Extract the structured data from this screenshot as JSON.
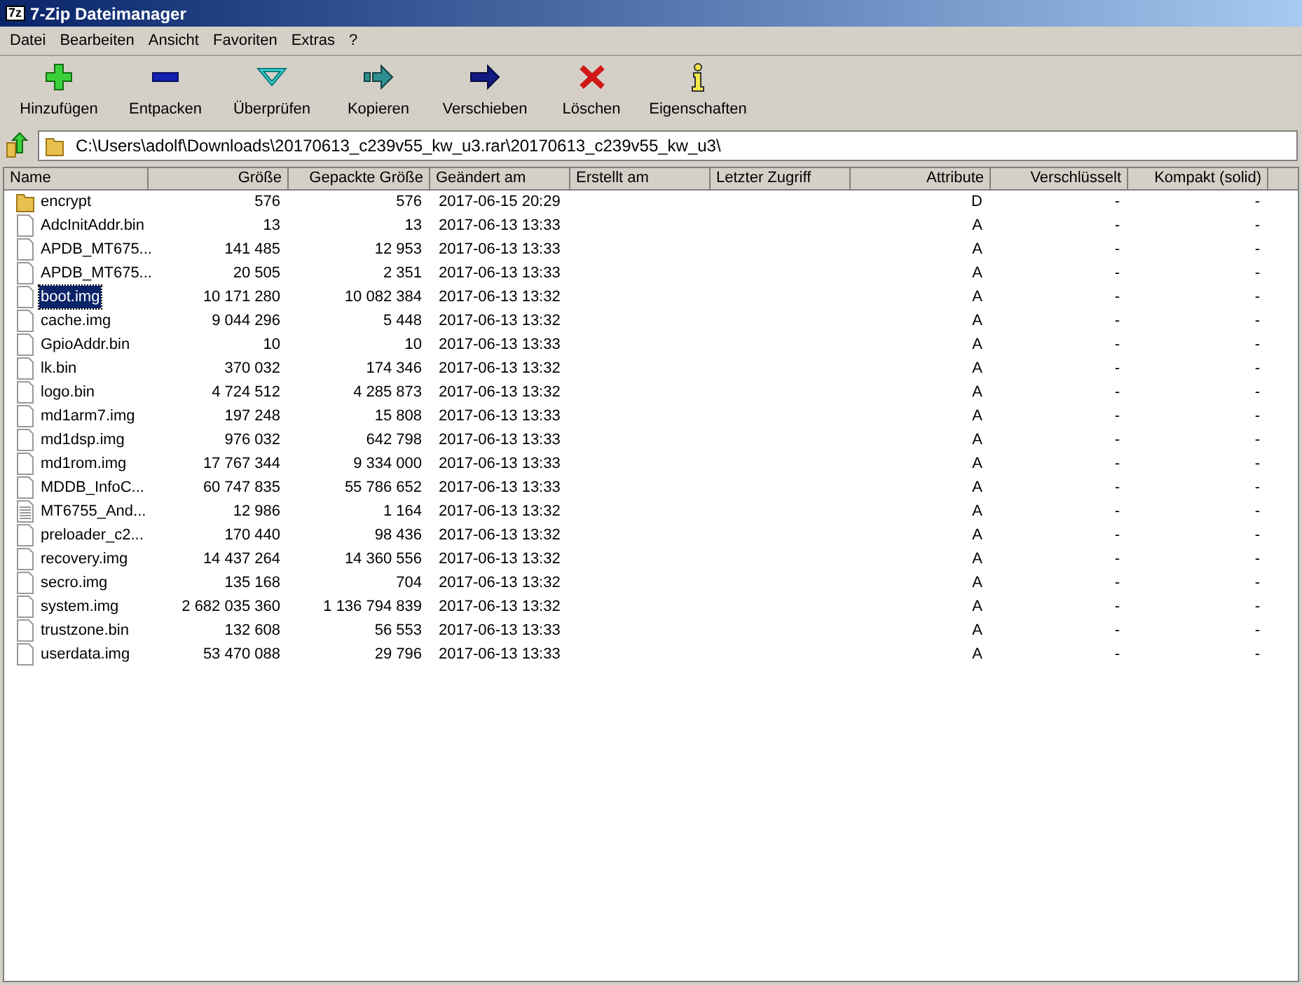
{
  "window": {
    "title": "7-Zip Dateimanager",
    "app_icon": "7z"
  },
  "menu": [
    "Datei",
    "Bearbeiten",
    "Ansicht",
    "Favoriten",
    "Extras",
    "?"
  ],
  "toolbar": [
    {
      "label": "Hinzufügen",
      "kind": "add"
    },
    {
      "label": "Entpacken",
      "kind": "extract"
    },
    {
      "label": "Überprüfen",
      "kind": "test"
    },
    {
      "label": "Kopieren",
      "kind": "copy"
    },
    {
      "label": "Verschieben",
      "kind": "move"
    },
    {
      "label": "Löschen",
      "kind": "delete"
    },
    {
      "label": "Eigenschaften",
      "kind": "info"
    }
  ],
  "path": "C:\\Users\\adolf\\Downloads\\20170613_c239v55_kw_u3.rar\\20170613_c239v55_kw_u3\\",
  "table": {
    "columns": [
      {
        "label": "Name"
      },
      {
        "label": "Größe"
      },
      {
        "label": "Gepackte Größe"
      },
      {
        "label": "Geändert am"
      },
      {
        "label": "Erstellt am"
      },
      {
        "label": "Letzter Zugriff"
      },
      {
        "label": "Attribute"
      },
      {
        "label": "Verschlüsselt"
      },
      {
        "label": "Kompakt (solid)"
      }
    ],
    "rows": [
      {
        "kind": "folder",
        "selected": false,
        "cells": [
          "encrypt",
          "576",
          "576",
          "2017-06-15 20:29",
          "",
          "",
          "D",
          "-",
          "-"
        ]
      },
      {
        "kind": "file",
        "selected": false,
        "cells": [
          "AdcInitAddr.bin",
          "13",
          "13",
          "2017-06-13 13:33",
          "",
          "",
          "A",
          "-",
          "-"
        ]
      },
      {
        "kind": "file",
        "selected": false,
        "cells": [
          "APDB_MT675...",
          "141 485",
          "12 953",
          "2017-06-13 13:33",
          "",
          "",
          "A",
          "-",
          "-"
        ]
      },
      {
        "kind": "file",
        "selected": false,
        "cells": [
          "APDB_MT675...",
          "20 505",
          "2 351",
          "2017-06-13 13:33",
          "",
          "",
          "A",
          "-",
          "-"
        ]
      },
      {
        "kind": "file",
        "selected": true,
        "cells": [
          "boot.img",
          "10 171 280",
          "10 082 384",
          "2017-06-13 13:32",
          "",
          "",
          "A",
          "-",
          "-"
        ]
      },
      {
        "kind": "file",
        "selected": false,
        "cells": [
          "cache.img",
          "9 044 296",
          "5 448",
          "2017-06-13 13:32",
          "",
          "",
          "A",
          "-",
          "-"
        ]
      },
      {
        "kind": "file",
        "selected": false,
        "cells": [
          "GpioAddr.bin",
          "10",
          "10",
          "2017-06-13 13:33",
          "",
          "",
          "A",
          "-",
          "-"
        ]
      },
      {
        "kind": "file",
        "selected": false,
        "cells": [
          "lk.bin",
          "370 032",
          "174 346",
          "2017-06-13 13:32",
          "",
          "",
          "A",
          "-",
          "-"
        ]
      },
      {
        "kind": "file",
        "selected": false,
        "cells": [
          "logo.bin",
          "4 724 512",
          "4 285 873",
          "2017-06-13 13:32",
          "",
          "",
          "A",
          "-",
          "-"
        ]
      },
      {
        "kind": "file",
        "selected": false,
        "cells": [
          "md1arm7.img",
          "197 248",
          "15 808",
          "2017-06-13 13:33",
          "",
          "",
          "A",
          "-",
          "-"
        ]
      },
      {
        "kind": "file",
        "selected": false,
        "cells": [
          "md1dsp.img",
          "976 032",
          "642 798",
          "2017-06-13 13:33",
          "",
          "",
          "A",
          "-",
          "-"
        ]
      },
      {
        "kind": "file",
        "selected": false,
        "cells": [
          "md1rom.img",
          "17 767 344",
          "9 334 000",
          "2017-06-13 13:33",
          "",
          "",
          "A",
          "-",
          "-"
        ]
      },
      {
        "kind": "file",
        "selected": false,
        "cells": [
          "MDDB_InfoC...",
          "60 747 835",
          "55 786 652",
          "2017-06-13 13:33",
          "",
          "",
          "A",
          "-",
          "-"
        ]
      },
      {
        "kind": "text",
        "selected": false,
        "cells": [
          "MT6755_And...",
          "12 986",
          "1 164",
          "2017-06-13 13:32",
          "",
          "",
          "A",
          "-",
          "-"
        ]
      },
      {
        "kind": "file",
        "selected": false,
        "cells": [
          "preloader_c2...",
          "170 440",
          "98 436",
          "2017-06-13 13:32",
          "",
          "",
          "A",
          "-",
          "-"
        ]
      },
      {
        "kind": "file",
        "selected": false,
        "cells": [
          "recovery.img",
          "14 437 264",
          "14 360 556",
          "2017-06-13 13:32",
          "",
          "",
          "A",
          "-",
          "-"
        ]
      },
      {
        "kind": "file",
        "selected": false,
        "cells": [
          "secro.img",
          "135 168",
          "704",
          "2017-06-13 13:32",
          "",
          "",
          "A",
          "-",
          "-"
        ]
      },
      {
        "kind": "file",
        "selected": false,
        "cells": [
          "system.img",
          "2 682 035 360",
          "1 136 794 839",
          "2017-06-13 13:32",
          "",
          "",
          "A",
          "-",
          "-"
        ]
      },
      {
        "kind": "file",
        "selected": false,
        "cells": [
          "trustzone.bin",
          "132 608",
          "56 553",
          "2017-06-13 13:33",
          "",
          "",
          "A",
          "-",
          "-"
        ]
      },
      {
        "kind": "file",
        "selected": false,
        "cells": [
          "userdata.img",
          "53 470 088",
          "29 796",
          "2017-06-13 13:33",
          "",
          "",
          "A",
          "-",
          "-"
        ]
      }
    ]
  }
}
